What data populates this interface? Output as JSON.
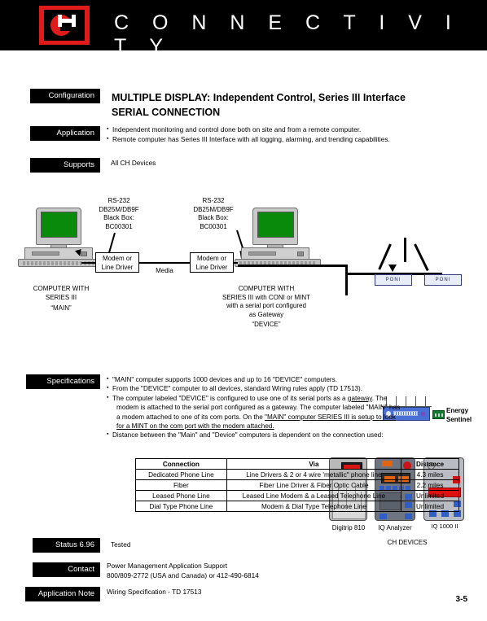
{
  "header": {
    "title": "C O N N E C T I V I T Y",
    "logo_alt": "CH",
    "logo_red": "#e01b1b"
  },
  "tags": {
    "configuration": "Configuration",
    "application": "Application",
    "supports": "Supports",
    "specifications": "Specifications",
    "status": "Status 6.96",
    "contact": "Contact",
    "application_note": "Application Note"
  },
  "title": {
    "line1": "MULTIPLE DISPLAY: Independent Control, Series III Interface",
    "line2": "SERIAL CONNECTION"
  },
  "application_bullets": [
    "Independent monitoring and control done both on site and from a remote computer.",
    "Remote computer has Series III Interface with all logging, alarming, and trending capabilities."
  ],
  "supports_text": "All CH  Devices",
  "diagram": {
    "left_connector": {
      "l1": "RS-232",
      "l2": "DB25M/DB9F",
      "l3": "Black Box:",
      "l4": "BC00301"
    },
    "right_connector": {
      "l1": "RS-232",
      "l2": "DB25M/DB9F",
      "l3": "Black Box:",
      "l4": "BC00301"
    },
    "modem_left": {
      "l1": "Modem or",
      "l2": "Line Driver"
    },
    "modem_right": {
      "l1": "Modem or",
      "l2": "Line Driver"
    },
    "media_label": "Media",
    "main_computer": {
      "l1": "COMPUTER WITH",
      "l2": "SERIES III",
      "l3": "“MAIN”"
    },
    "device_computer": {
      "l1": "COMPUTER WITH",
      "l2": "SERIES III with CONI or MINT",
      "l3": "with a serial port configured",
      "l4": "as Gateway",
      "l5": "“DEVICE”"
    },
    "energy_sentinel": {
      "l1": "Energy",
      "l2": "Sentinel"
    },
    "poni_label": "PONI",
    "devices": [
      {
        "name": "Digitrip 810"
      },
      {
        "name": "IQ Analyzer"
      },
      {
        "name": "IQ 1000 II"
      }
    ],
    "devices_caption": "CH  DEVICES"
  },
  "specifications": {
    "b1": "\"MAIN\" computer supports 1000 devices and up to 16 \"DEVICE\" computers.",
    "b2": "From the \"DEVICE\" computer  to all devices, standard Wiring rules apply (TD 17513).",
    "b3_a": "The computer labeled \"DEVICE\" is configured to use one of its serial ports as a ",
    "b3_u": "gateway",
    "b3_b": ".  The",
    "b3_line2": "modem is attached to the serial port configured as a gateway. The computer labeled \"MAIN\"  has",
    "b3_line3_a": "a modem attached to one of its com ports.  On the ",
    "b3_line3_u": "\"MAIN\" computer SERIES III  is setup to look",
    "b3_line4_u": "for a MINT on the com port  with the modem attached.",
    "b4": "Distance between  the \"Main\" and \"Device\" computers is dependent on the connection used:"
  },
  "table": {
    "headers": [
      "Connection",
      "Via",
      "Distance"
    ],
    "rows": [
      [
        "Dedicated Phone Line",
        "Line Drivers &  2 or 4 wire 'metallic\" phone line",
        "4.3 miles"
      ],
      [
        "Fiber",
        "Fiber Line Driver & Fiber Optic Cable",
        "2.2 miles"
      ],
      [
        "Leased Phone Line",
        "Leased Line Modem &  a Leased Telephone Line",
        "Unlimited"
      ],
      [
        "Dial Type Phone Line",
        "Modem & Dial Type Telephone Line",
        "Unlimited"
      ]
    ]
  },
  "bottom": {
    "status_value": "Tested",
    "contact_line1": "Power Management Application Support",
    "contact_line2": "800/809-2772 (USA and Canada) or 412-490-6814",
    "appnote_value": "Wiring Specification - TD 17513",
    "page_number": "3-5"
  }
}
